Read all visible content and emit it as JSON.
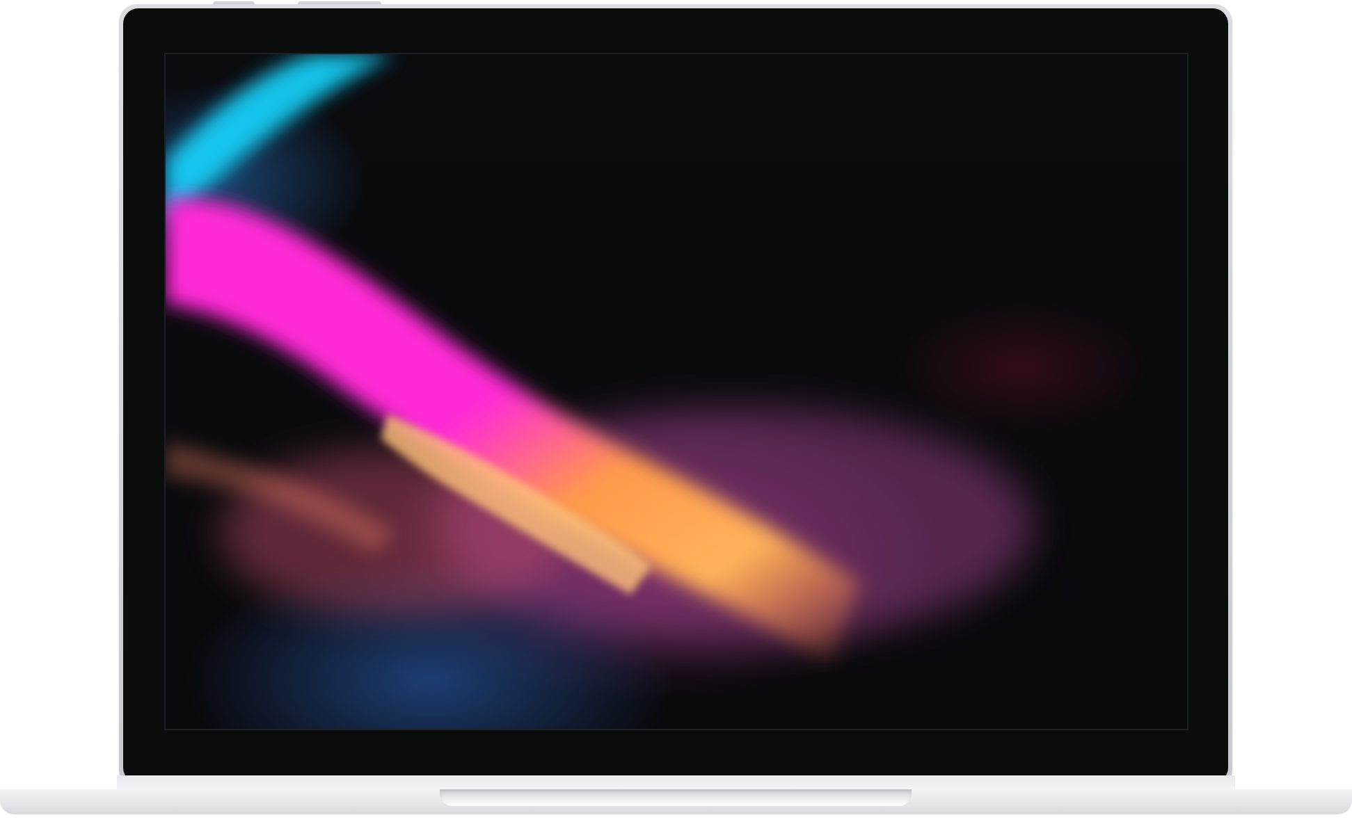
{
  "device": {
    "kind": "laptop-mockup",
    "bezel_color": "#0b0d0c",
    "body_color": "#dcdde0"
  },
  "screen": {
    "wallpaper": "abstract-light-streaks",
    "colors": {
      "cyan": "#19d6ff",
      "magenta": "#ff2bd6",
      "orange": "#ffa04a",
      "blue": "#2f6fc0",
      "background": "#0a0a0e"
    }
  }
}
